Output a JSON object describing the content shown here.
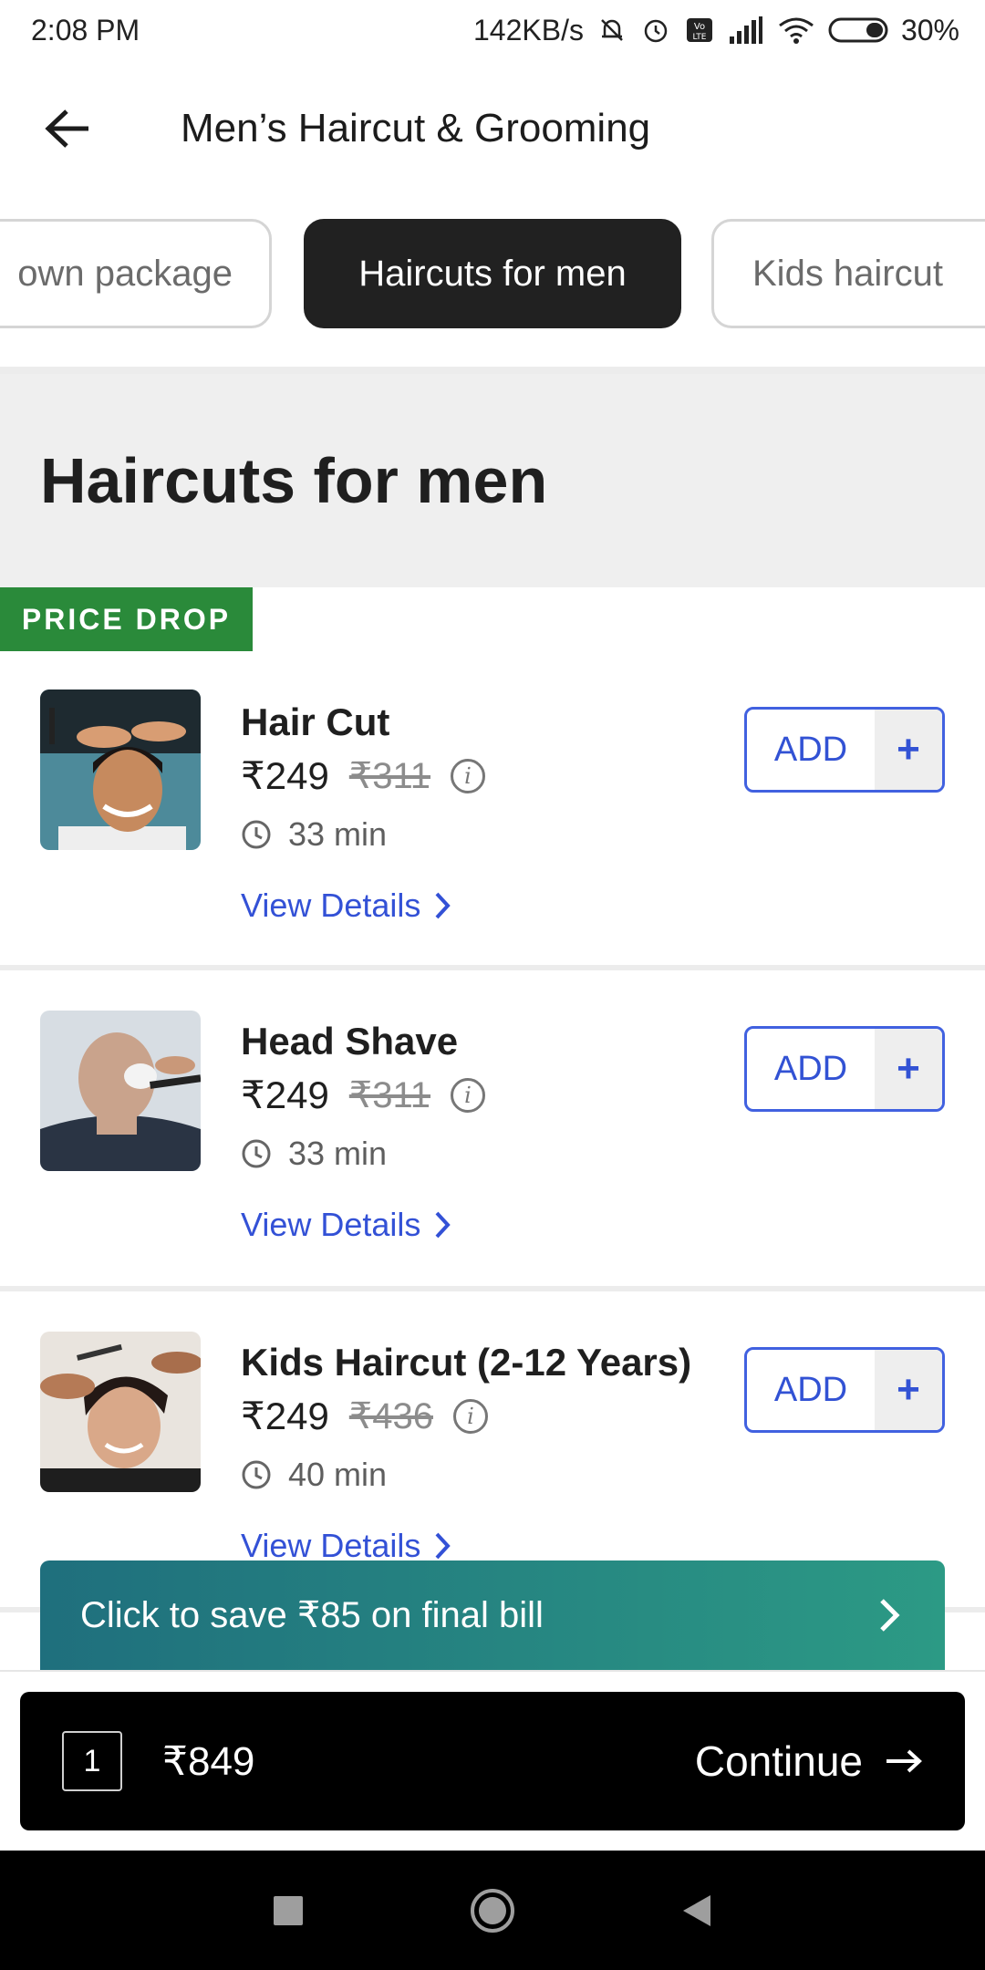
{
  "status_bar": {
    "time": "2:08 PM",
    "network_speed": "142KB/s",
    "battery": "30%",
    "icons": [
      "mute-icon",
      "alarm-icon",
      "volte-icon",
      "signal-icon",
      "wifi-icon",
      "battery-icon"
    ]
  },
  "header": {
    "title": "Men’s Haircut & Grooming",
    "back_icon": "back-arrow-icon"
  },
  "chips": [
    {
      "label": "own package",
      "active": false
    },
    {
      "label": "Haircuts for men",
      "active": true
    },
    {
      "label": "Kids haircut",
      "active": false
    }
  ],
  "section": {
    "title": "Haircuts for men",
    "badge": "PRICE DROP"
  },
  "services": [
    {
      "name": "Hair Cut",
      "price": "₹249",
      "old_price": "₹311",
      "duration": "33 min",
      "details_label": "View Details",
      "add_label": "ADD",
      "add_plus": "+"
    },
    {
      "name": "Head Shave",
      "price": "₹249",
      "old_price": "₹311",
      "duration": "33 min",
      "details_label": "View Details",
      "add_label": "ADD",
      "add_plus": "+"
    },
    {
      "name": "Kids Haircut (2-12 Years)",
      "price": "₹249",
      "old_price": "₹436",
      "duration": "40 min",
      "details_label": "View Details",
      "add_label": "ADD",
      "add_plus": "+"
    }
  ],
  "savings_banner": {
    "text": "Click to save ₹85 on final bill"
  },
  "cart_bar": {
    "count": "1",
    "total": "₹849",
    "continue_label": "Continue"
  },
  "colors": {
    "accent_blue": "#3252d4",
    "price_drop_green": "#2a8a3a",
    "chip_active": "#212121",
    "banner_gradient_start": "#1f6f7d",
    "banner_gradient_end": "#2c9a85"
  }
}
